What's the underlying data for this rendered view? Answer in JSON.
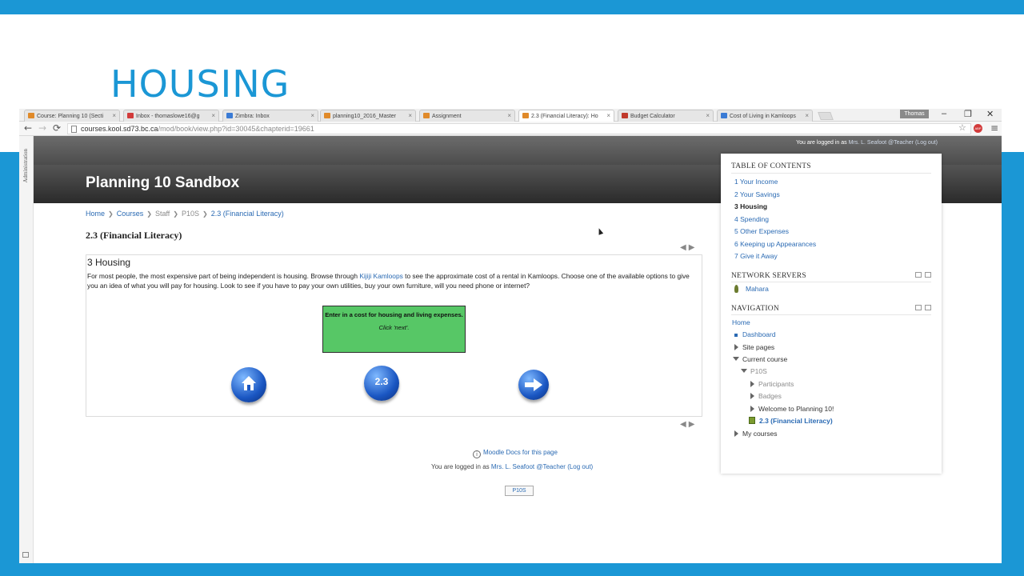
{
  "slide": {
    "title": "HOUSING"
  },
  "browser": {
    "tabs": [
      {
        "label": "Course: Planning 10 (Secti",
        "fav": "moodle-icon",
        "color": "#e08a2a"
      },
      {
        "label": "Inbox - thomaslowe16@g",
        "fav": "gmail-icon",
        "color": "#d23b3b"
      },
      {
        "label": "Zimbra: Inbox",
        "fav": "zimbra-icon",
        "color": "#3a7bd5"
      },
      {
        "label": "planning10_2016_Master",
        "fav": "moodle-icon",
        "color": "#e08a2a"
      },
      {
        "label": "Assignment",
        "fav": "moodle-icon",
        "color": "#e08a2a"
      },
      {
        "label": "2.3 (Financial Literacy): Ho",
        "fav": "moodle-icon",
        "color": "#e08a2a"
      },
      {
        "label": "Budget Calculator",
        "fav": "maple-leaf-icon",
        "color": "#c0392b"
      },
      {
        "label": "Cost of Living in Kamloops",
        "fav": "site-icon",
        "color": "#3a7bd5"
      }
    ],
    "active_tab_index": 5,
    "user_button": "Thomas",
    "url_host": "courses.kool.sd73.bc.ca",
    "url_path": "/mod/book/view.php?id=30045&chapterid=19661",
    "abp": "ABP"
  },
  "moodle": {
    "admin_label": "Administration",
    "logged_in_top_prefix": "You are logged in as",
    "logged_in_top_user": "Mrs. L. Seafoot @Teacher",
    "logged_in_top_logout": "(Log out)",
    "site_name": "Planning 10 Sandbox",
    "breadcrumbs": [
      "Home",
      "Courses",
      "Staff",
      "P10S",
      "2.3 (Financial Literacy)"
    ],
    "book_title": "2.3 (Financial Literacy)",
    "chapter_title": "3 Housing",
    "para_before_link": "For most people, the most expensive part of being independent is housing.  Browse through ",
    "para_link": "Kijiji Kamloops",
    "para_after_link": "  to see the approximate cost of a rental in Kamloops.   Choose one of the available options to give you an idea of what you will pay for housing.  Look to see if you have to pay your own utilities, buy your own furniture, will you need phone or internet?",
    "green_box_main": "Enter in a cost for housing and living expenses.",
    "green_box_hint": "Click 'next'.",
    "nav_badge": "2.3",
    "footer_docs": "Moodle Docs for this page",
    "footer_login_prefix": "You are logged in as",
    "footer_login_user": "Mrs. L. Seafoot @Teacher",
    "footer_login_logout": "(Log out)",
    "footer_course": "P10S"
  },
  "toc": {
    "title": "TABLE OF CONTENTS",
    "items": [
      "1 Your Income",
      "2 Your Savings",
      "3 Housing",
      "4 Spending",
      "5 Other Expenses",
      "6 Keeping up Appearances",
      "7 Give it Away"
    ],
    "current_index": 2
  },
  "network": {
    "title": "NETWORK SERVERS",
    "item": "Mahara"
  },
  "navigation": {
    "title": "NAVIGATION",
    "home": "Home",
    "dashboard": "Dashboard",
    "site_pages": "Site pages",
    "current_course": "Current course",
    "course_code": "P10S",
    "participants": "Participants",
    "badges": "Badges",
    "welcome": "Welcome to Planning 10!",
    "current_book": "2.3 (Financial Literacy)",
    "my_courses": "My courses"
  }
}
